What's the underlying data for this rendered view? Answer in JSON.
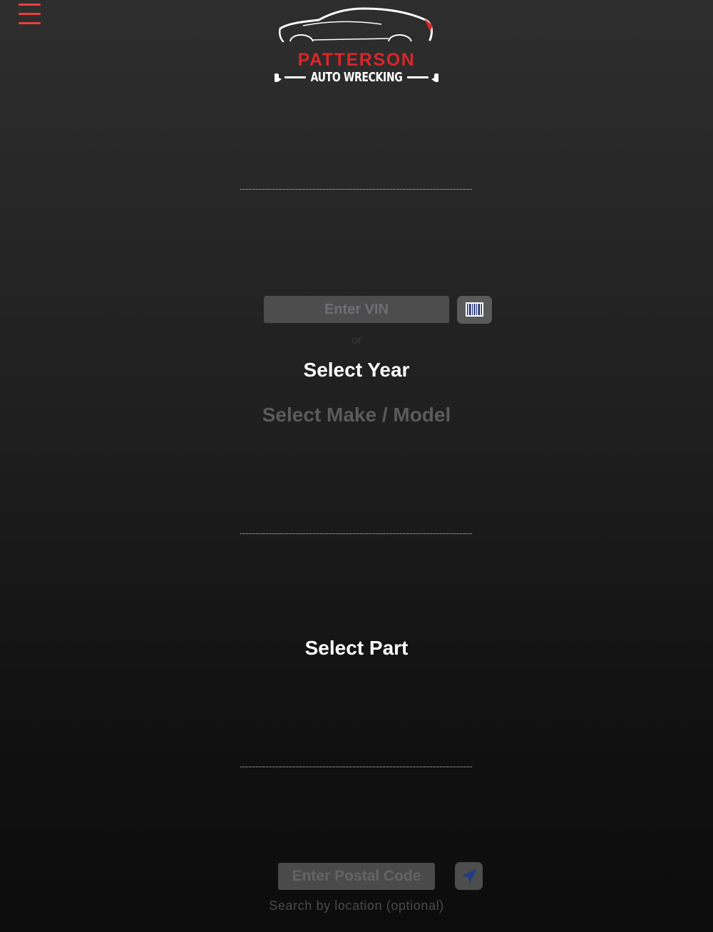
{
  "header": {
    "menu_icon": "hamburger-menu-icon",
    "logo": {
      "line1": "PATTERSON",
      "line2": "AUTO WRECKING",
      "colors": {
        "brand_red": "#d8262a",
        "logo_white": "#ffffff"
      }
    }
  },
  "vin": {
    "placeholder": "Enter VIN",
    "scan_icon": "barcode-icon"
  },
  "or_text": "or",
  "year": {
    "label": "Select Year"
  },
  "make_model": {
    "label": "Select Make / Model"
  },
  "part": {
    "label": "Select Part"
  },
  "location": {
    "placeholder": "Enter Postal Code",
    "locate_icon": "location-arrow-icon",
    "hint": "Search by location (optional)"
  },
  "colors": {
    "accent_red": "#e8403c",
    "location_arrow_blue": "#1e3a8a",
    "barcode_blue": "#1a2a6c"
  }
}
